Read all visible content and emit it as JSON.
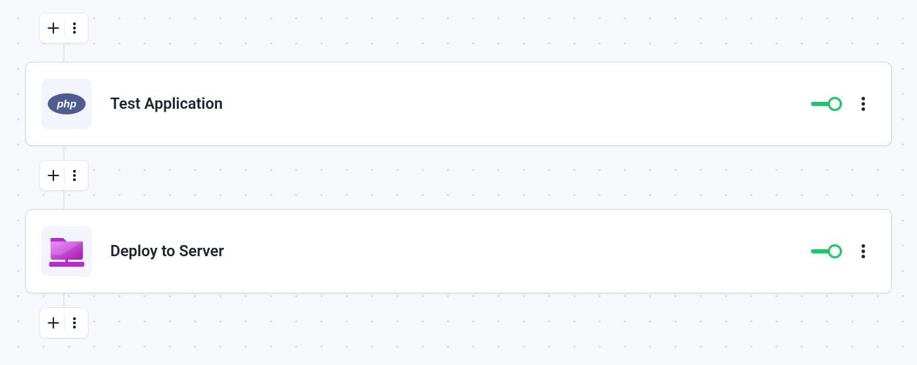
{
  "steps": [
    {
      "title": "Test Application",
      "icon": "php",
      "enabled": true
    },
    {
      "title": "Deploy to Server",
      "icon": "deploy-folder",
      "enabled": true
    }
  ],
  "colors": {
    "toggle_on": "#18c964",
    "card_border": "#cfd8ee",
    "php_badge": "#4f5b93",
    "deploy_magenta": "#c026d3"
  }
}
